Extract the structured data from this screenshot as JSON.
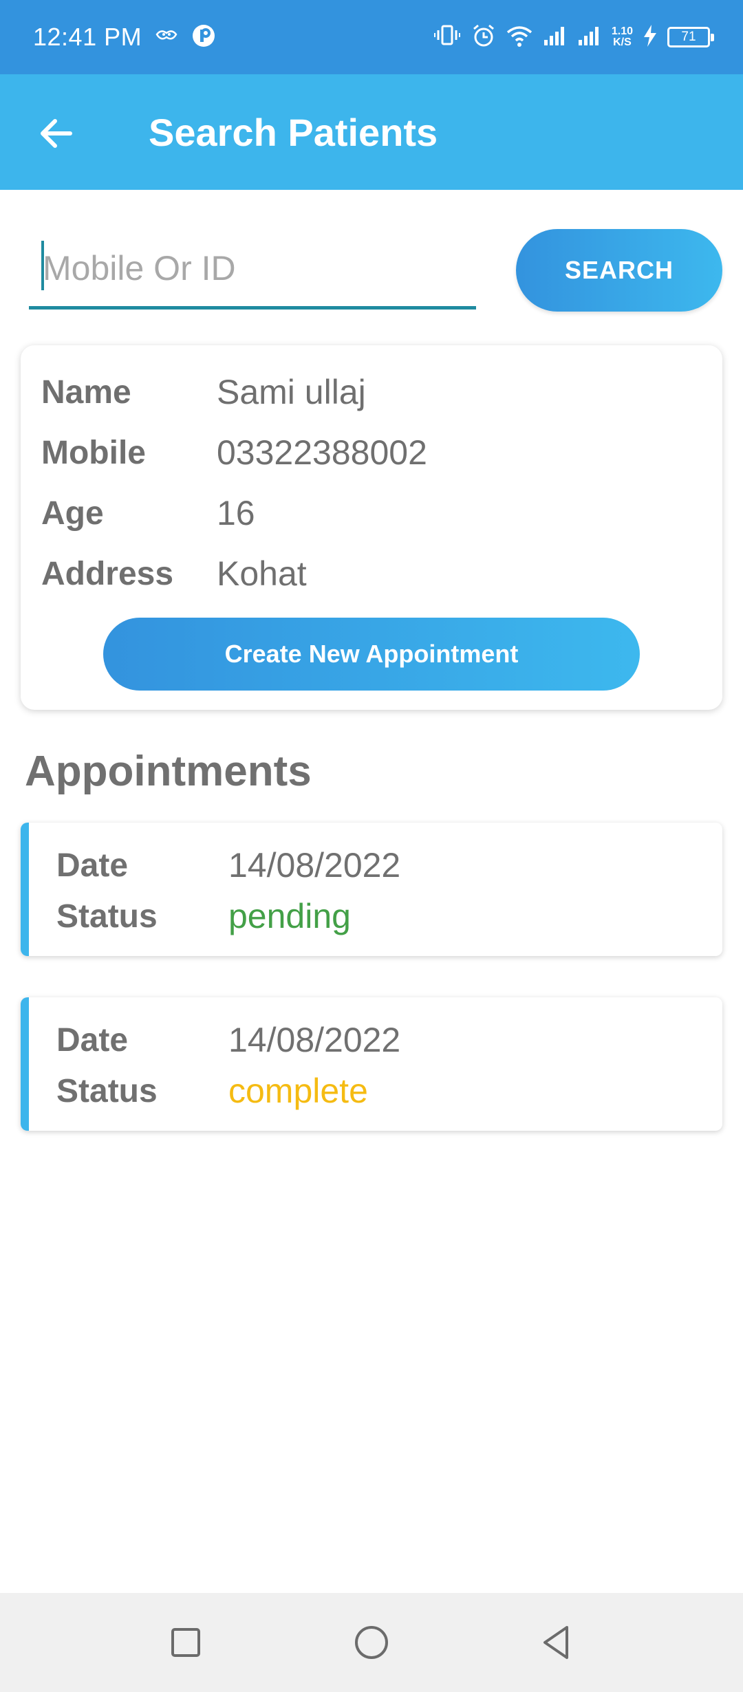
{
  "status_bar": {
    "time": "12:41 PM",
    "speed_value": "1.10",
    "speed_unit": "K/S",
    "battery": "71"
  },
  "app_bar": {
    "title": "Search Patients"
  },
  "search": {
    "placeholder": "Mobile Or ID",
    "value": "",
    "button_label": "SEARCH"
  },
  "patient": {
    "fields": [
      {
        "label": "Name",
        "value": "Sami ullaj"
      },
      {
        "label": "Mobile",
        "value": "03322388002"
      },
      {
        "label": "Age",
        "value": "16"
      },
      {
        "label": "Address",
        "value": "Kohat"
      }
    ],
    "create_button_label": "Create New Appointment"
  },
  "appointments": {
    "title": "Appointments",
    "items": [
      {
        "date_label": "Date",
        "date": "14/08/2022",
        "status_label": "Status",
        "status": "pending",
        "status_color": "#43a047"
      },
      {
        "date_label": "Date",
        "date": "14/08/2022",
        "status_label": "Status",
        "status": "complete",
        "status_color": "#f5bb12"
      }
    ]
  },
  "colors": {
    "status_bar": "#3393de",
    "app_bar": "#3db5ec",
    "accent": "#3db5ec",
    "input_underline": "#1f8ba0"
  }
}
